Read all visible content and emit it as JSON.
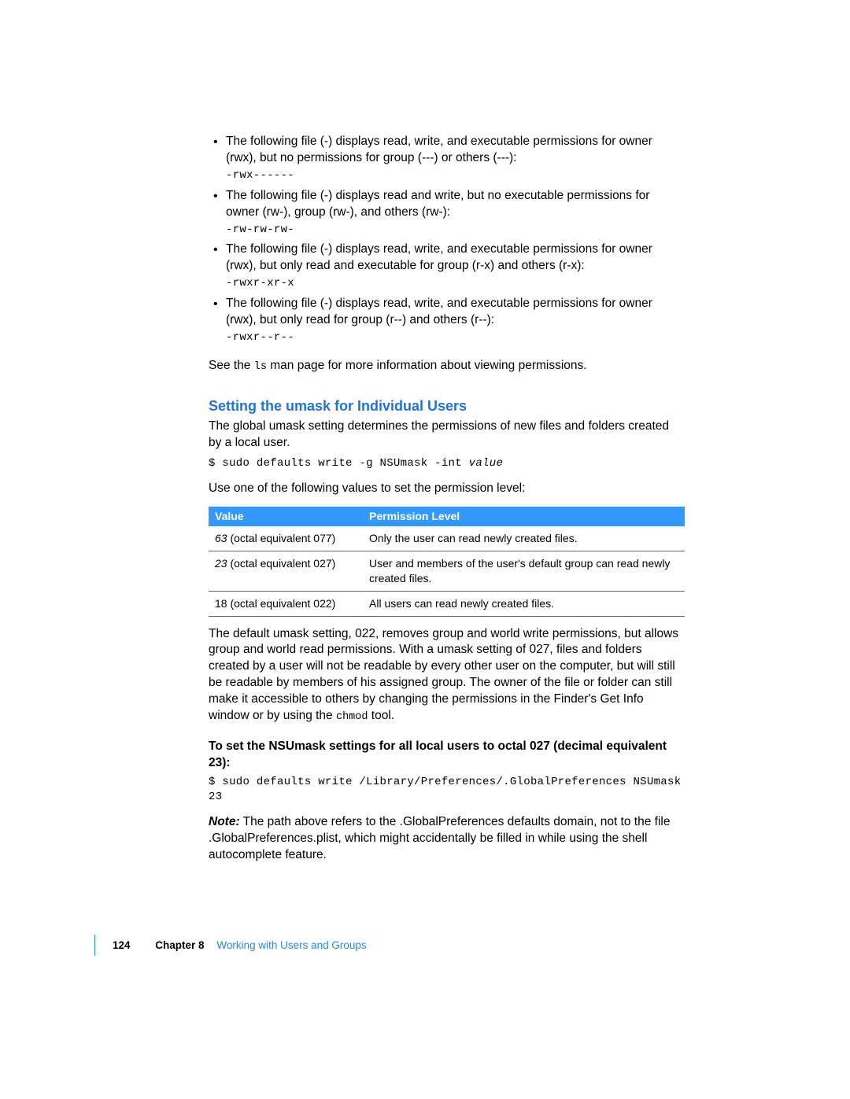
{
  "bullets": [
    {
      "text": "The following file (-) displays read, write, and executable permissions for owner (rwx), but no permissions for group (---) or others (---):",
      "code": "-rwx------"
    },
    {
      "text": "The following file (-) displays read and write, but no executable permissions for owner (rw-), group (rw-), and others (rw-):",
      "code": "-rw-rw-rw-"
    },
    {
      "text": "The following file (-) displays read, write, and executable permissions for owner (rwx), but only read and executable for group (r-x) and others (r-x):",
      "code": "-rwxr-xr-x"
    },
    {
      "text": "The following file (-) displays read, write, and executable permissions for owner (rwx), but only read for group (r--) and others (r--):",
      "code": "-rwxr--r--"
    }
  ],
  "see_line": {
    "pre": "See the ",
    "code": "ls",
    "post": " man page for more information about viewing permissions."
  },
  "heading": "Setting the umask for Individual Users",
  "umask_intro": "The global umask setting determines the permissions of new files and folders created by a local user.",
  "umask_cmd_prefix": "$ sudo defaults write -g NSUmask -int ",
  "umask_cmd_arg": "value",
  "use_values": "Use one of the following values to set the permission level:",
  "table": {
    "head": {
      "c1": "Value",
      "c2": "Permission Level"
    },
    "rows": [
      {
        "num": "63",
        "rest": " (octal equivalent 077)",
        "desc": "Only the user can read newly created files."
      },
      {
        "num": "23",
        "rest": " (octal equivalent 027)",
        "desc": "User and members of the user's default group can read newly created files."
      },
      {
        "num": "18",
        "rest": " (octal equivalent 022)",
        "desc": "All users can read newly created files."
      }
    ]
  },
  "default_umask_pre": "The default umask setting, 022, removes group and world write permissions, but allows group and world read permissions. With a umask setting of 027, files and folders created by a user will not be readable by every other user on the computer, but will still be readable by members of his assigned group. The owner of the file or folder can still make it accessible to others by changing the permissions in the Finder's Get Info window or by using the ",
  "chmod": "chmod",
  "default_umask_post": " tool.",
  "subheading": "To set the NSUmask settings for all local users to octal 027 (decimal equivalent 23):",
  "cmd2": "$ sudo defaults write /Library/Preferences/.GlobalPreferences NSUmask 23",
  "note_label": "Note:",
  "note_text": "  The path above refers to the .GlobalPreferences defaults domain, not to the file .GlobalPreferences.plist, which might accidentally be filled in while using the shell autocomplete feature.",
  "footer": {
    "page": "124",
    "chapter": "Chapter 8",
    "title": "Working with Users and Groups"
  }
}
